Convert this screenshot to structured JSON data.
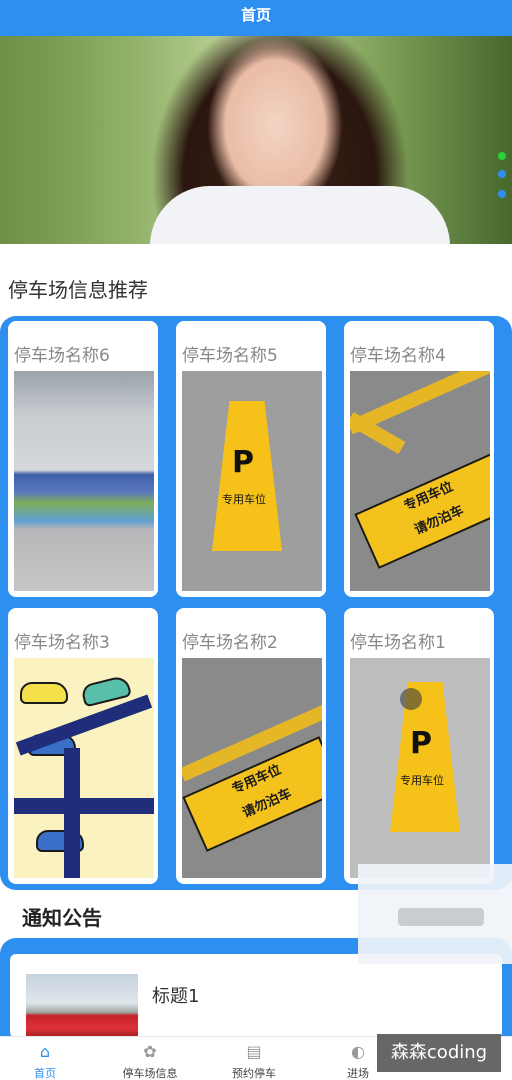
{
  "header": {
    "title": "首页"
  },
  "recommend": {
    "title": "停车场信息推荐",
    "cards": [
      {
        "name": "停车场名称6"
      },
      {
        "name": "停车场名称5"
      },
      {
        "name": "停车场名称4"
      },
      {
        "name": "停车场名称3"
      },
      {
        "name": "停车场名称2"
      },
      {
        "name": "停车场名称1"
      }
    ]
  },
  "notices": {
    "title": "通知公告",
    "items": [
      {
        "title": "标题1"
      }
    ]
  },
  "tabbar": {
    "items": [
      {
        "label": "首页",
        "icon": "home-icon",
        "active": true
      },
      {
        "label": "停车场信息",
        "icon": "grid-icon"
      },
      {
        "label": "预约停车",
        "icon": "calendar-icon"
      },
      {
        "label": "进场",
        "icon": "enter-icon"
      }
    ]
  },
  "sign_text": {
    "p": "P",
    "reserved": "专用车位"
  },
  "plate_text": {
    "line1": "专用车位",
    "line2": "请勿泊车"
  },
  "watermark": "森森coding",
  "colors": {
    "primary": "#2d8ff0",
    "sign_yellow": "#f6c21a",
    "card_bg": "#ffffff"
  }
}
